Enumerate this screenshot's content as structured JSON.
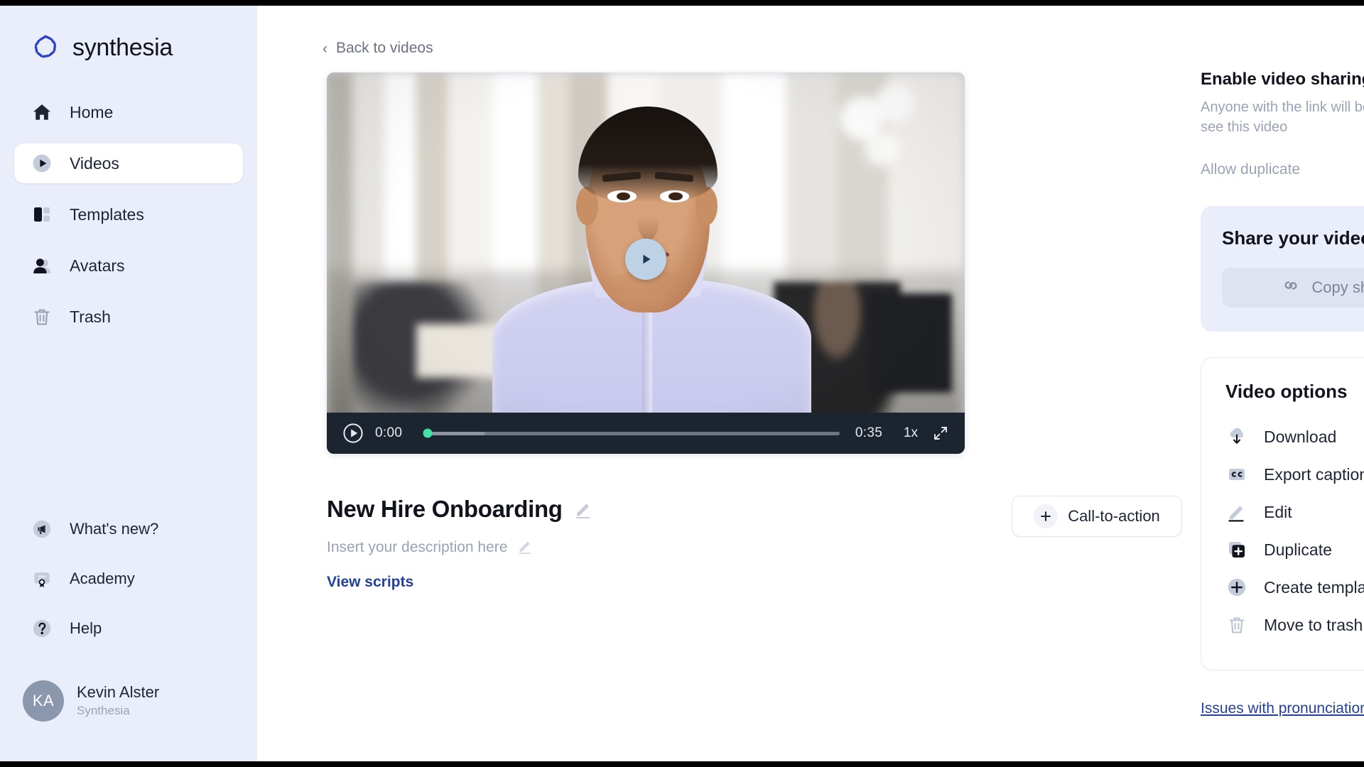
{
  "brand": {
    "name": "synthesia",
    "logo_icon": "synthesia-logo-icon"
  },
  "sidebar": {
    "primary_items": [
      {
        "label": "Home",
        "icon": "home-icon"
      },
      {
        "label": "Videos",
        "icon": "video-play-icon",
        "active": true
      },
      {
        "label": "Templates",
        "icon": "templates-icon"
      },
      {
        "label": "Avatars",
        "icon": "avatars-icon"
      },
      {
        "label": "Trash",
        "icon": "trash-icon"
      }
    ],
    "secondary_items": [
      {
        "label": "What's new?",
        "icon": "megaphone-icon"
      },
      {
        "label": "Academy",
        "icon": "academy-icon"
      },
      {
        "label": "Help",
        "icon": "question-circle-icon"
      }
    ],
    "user": {
      "initials": "KA",
      "name": "Kevin Alster",
      "org": "Synthesia"
    }
  },
  "main": {
    "back_link": "Back to videos",
    "back_icon": "chevron-left-icon",
    "player": {
      "play_overlay_icon": "play-icon",
      "play_button_icon": "play-circle-icon",
      "current_time": "0:00",
      "duration": "0:35",
      "playback_rate": "1x",
      "fullscreen_icon": "fullscreen-icon",
      "progress_percent": 0
    },
    "video_title": "New Hire Onboarding",
    "title_edit_icon": "pencil-icon",
    "description_placeholder": "Insert your description here",
    "description_edit_icon": "pencil-icon",
    "view_scripts_link": "View scripts",
    "cta_button": {
      "label": "Call-to-action",
      "icon": "plus-icon"
    }
  },
  "right_panel": {
    "sharing": {
      "title": "Enable video sharing",
      "subtitle": "Anyone with the link will be able to see this video",
      "value": "No",
      "enabled": false
    },
    "duplicate": {
      "label": "Allow duplicate",
      "value": "No",
      "enabled": false
    },
    "share_card": {
      "title": "Share your video",
      "copy_label": "Copy shareable link",
      "copy_icon": "link-icon",
      "share_icon": "share-upload-icon"
    },
    "video_options": {
      "title": "Video options",
      "items": [
        {
          "label": "Download",
          "icon": "cloud-download-icon"
        },
        {
          "label": "Export captions (.srt)",
          "icon": "closed-captions-icon"
        },
        {
          "label": "Edit",
          "icon": "pencil-icon"
        },
        {
          "label": "Duplicate",
          "icon": "duplicate-icon"
        },
        {
          "label": "Create template",
          "icon": "plus-circle-icon"
        },
        {
          "label": "Move to trash",
          "icon": "trash-icon"
        }
      ]
    },
    "issues_link": "Issues with pronunciation or pauses?"
  },
  "colors": {
    "sidebar_bg": "#eaeefa",
    "accent_link": "#23419c",
    "progress_knob": "#45e0a8",
    "controls_bg": "#1c2430"
  }
}
